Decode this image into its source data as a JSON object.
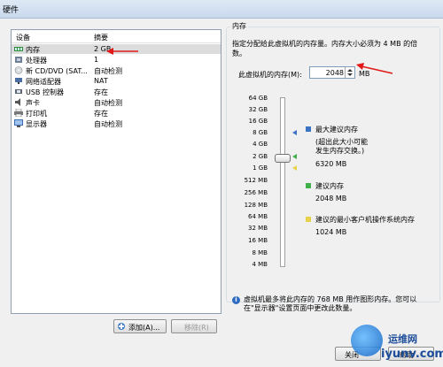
{
  "window": {
    "title": "硬件"
  },
  "device_list": {
    "header": {
      "device": "设备",
      "summary": "摘要"
    },
    "items": [
      {
        "name": "内存",
        "summary": "2 GB",
        "icon": "memory-icon",
        "selected": true
      },
      {
        "name": "处理器",
        "summary": "1",
        "icon": "processor-icon"
      },
      {
        "name": "新 CD/DVD (SAT...",
        "summary": "自动检测",
        "icon": "cd-dvd-icon"
      },
      {
        "name": "网络适配器",
        "summary": "NAT",
        "icon": "network-adapter-icon"
      },
      {
        "name": "USB 控制器",
        "summary": "存在",
        "icon": "usb-icon"
      },
      {
        "name": "声卡",
        "summary": "自动检测",
        "icon": "sound-card-icon"
      },
      {
        "name": "打印机",
        "summary": "存在",
        "icon": "printer-icon"
      },
      {
        "name": "显示器",
        "summary": "自动检测",
        "icon": "display-icon"
      }
    ]
  },
  "buttons": {
    "add": "添加(A)...",
    "remove": "移除(R)",
    "ok": "关闭",
    "help": "帮助"
  },
  "memory": {
    "group_title": "内存",
    "description": "指定分配给此虚拟机的内存量。内存大小必须为 4 MB 的倍数。",
    "label": "此虚拟机的内存(M):",
    "value": "2048",
    "unit": "MB",
    "scale": [
      "64 GB",
      "32 GB",
      "16 GB",
      "8 GB",
      "4 GB",
      "2 GB",
      "1 GB",
      "512 MB",
      "256 MB",
      "128 MB",
      "64 MB",
      "32 MB",
      "16 MB",
      "8 MB",
      "4 MB"
    ],
    "legend": [
      {
        "title": "最大建议内存",
        "note": "(超出此大小可能",
        "note2": "发生内存交换。)",
        "value": "6320 MB",
        "color": "#3a72c4"
      },
      {
        "title": "建议内存",
        "value": "2048 MB",
        "color": "#3fb04a"
      },
      {
        "title": "建议的最小客户机操作系统内存",
        "value": "1024 MB",
        "color": "#e8d24a"
      }
    ],
    "info": "虚拟机最多将此内存的 768 MB 用作图形内存。您可以在\"显示器\"设置页面中更改此数量。"
  },
  "watermark": {
    "title": "运维网",
    "url": "iyunv.com"
  }
}
